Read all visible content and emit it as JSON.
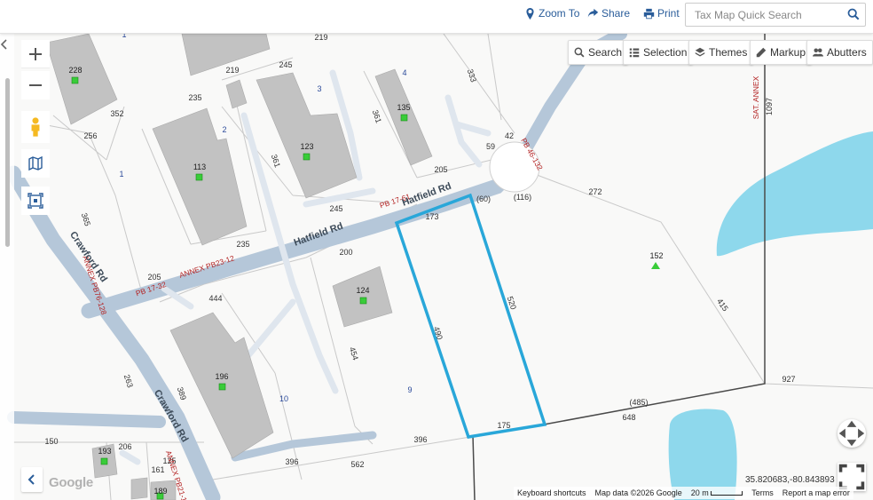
{
  "topbar": {
    "zoom_to": "Zoom To",
    "share": "Share",
    "print": "Print",
    "search_placeholder": "Tax Map Quick Search"
  },
  "toolbar": {
    "search": "Search",
    "selection": "Selection",
    "themes": "Themes",
    "markup": "Markup",
    "abutters": "Abutters"
  },
  "icons": [
    "location-pin-icon",
    "share-icon",
    "print-icon",
    "search-icon",
    "list-icon",
    "layers-icon",
    "pencil-icon",
    "users-icon",
    "plus-icon",
    "minus-icon",
    "pegman-icon",
    "map-icon",
    "extent-icon",
    "chevron-left-icon",
    "compass-icon",
    "fullscreen-icon"
  ],
  "colors": {
    "selected_parcel": "#29a7d9",
    "parcel_line": "#c8c8c8",
    "road": "#b5c7d9",
    "water": "#8ed8ec",
    "building": "#c0c0c0",
    "marker": "#33cc33",
    "red_label": "#b42424",
    "blue_label": "#2b4a9a"
  },
  "map": {
    "roads": [
      {
        "name": "Hatfield Rd"
      },
      {
        "name": "Hatfield Rd"
      },
      {
        "name": "Crawford Rd"
      },
      {
        "name": "Crawford Rd"
      }
    ],
    "parcels": [
      "228",
      "113",
      "123",
      "135",
      "124",
      "196",
      "193",
      "189",
      "152"
    ],
    "lot_numbers": [
      "1",
      "2",
      "3",
      "4",
      "1",
      "9",
      "10"
    ],
    "dimensions": [
      "219",
      "219",
      "245",
      "235",
      "352",
      "256",
      "361",
      "333",
      "361",
      "59",
      "42",
      "205",
      "245",
      "235",
      "200",
      "205",
      "173",
      "(60)",
      "(116)",
      "272",
      "365",
      "444",
      "454",
      "490",
      "520",
      "415",
      "927",
      "(485)",
      "648",
      "175",
      "396",
      "396",
      "562",
      "263",
      "389",
      "150",
      "206",
      "125",
      "161",
      "1097"
    ],
    "plat_refs": [
      "PB 46-132",
      "PB 17-61",
      "ANNEX PB23-12",
      "PB 17-32",
      "ANNEX PB76-128",
      "ANNEX PB21-1",
      "SAT. ANNEX"
    ]
  },
  "coordinates": "35.820683,-80.843893",
  "attribution": {
    "keyboard": "Keyboard shortcuts",
    "map_data": "Map data ©2026 Google",
    "scale": "20 m",
    "terms": "Terms",
    "report": "Report a map error"
  },
  "google_logo": "Google"
}
